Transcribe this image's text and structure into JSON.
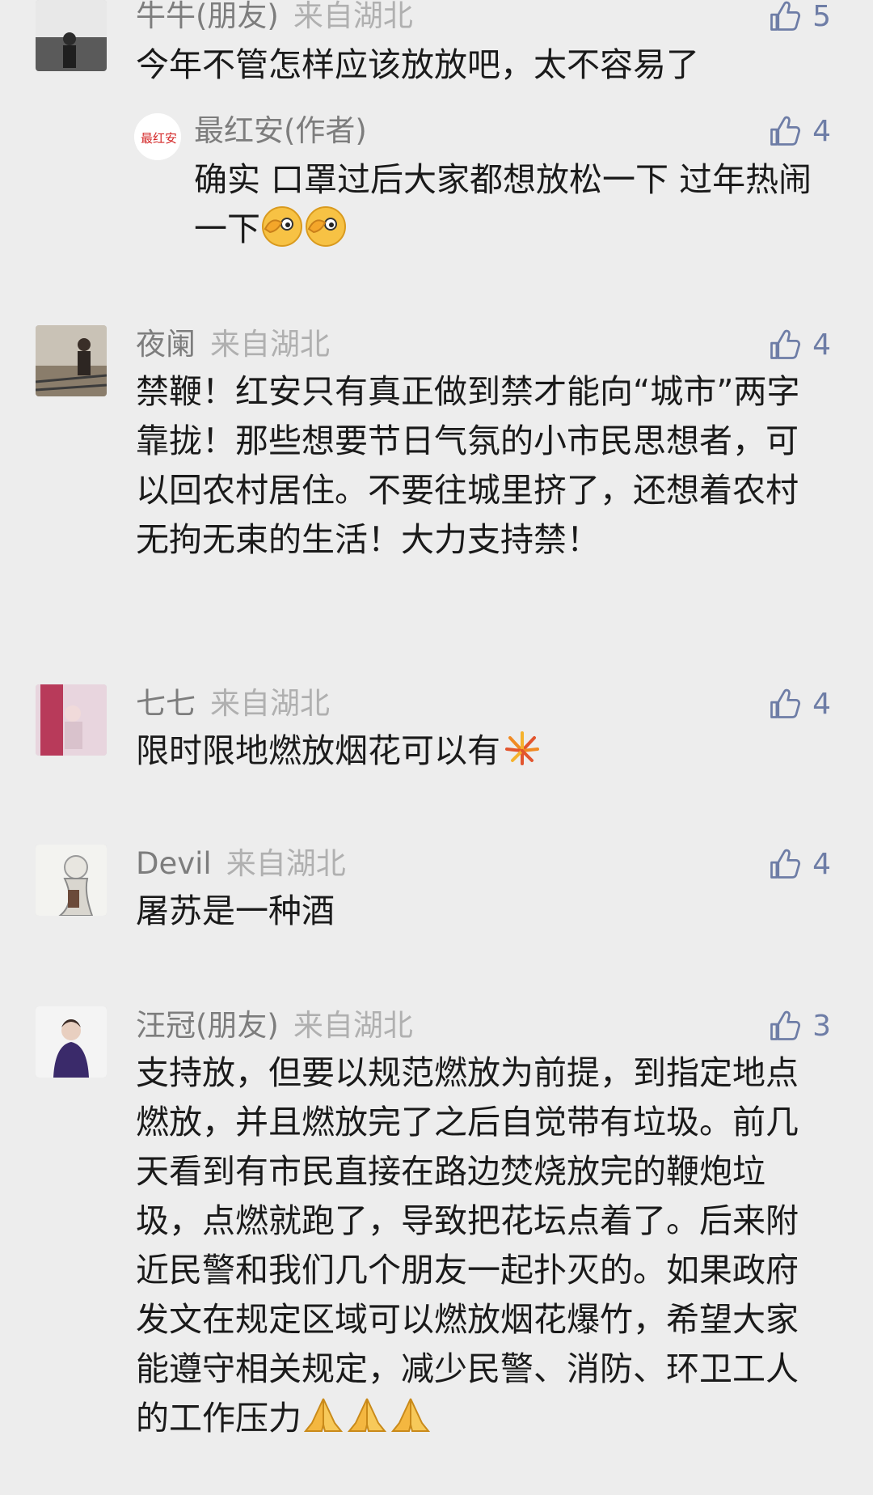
{
  "comments": [
    {
      "name": "牛牛(朋友)",
      "location": "来自湖北",
      "text": "今年不管怎样应该放放吧，太不容易了",
      "likes": "5",
      "reply": {
        "name": "最红安(作者)",
        "text": "确实 口罩过后大家都想放松一下  过年热闹一下",
        "likes": "4",
        "avatar_text": "最红安"
      }
    },
    {
      "name": "夜阑",
      "location": "来自湖北",
      "text": "禁鞭！红安只有真正做到禁才能向“城市”两字靠拢！那些想要节日气氛的小市民思想者，可以回农村居住。不要往城里挤了，还想着农村无拘无束的生活！大力支持禁！",
      "likes": "4"
    },
    {
      "name": "七七",
      "location": "来自湖北",
      "text": "限时限地燃放烟花可以有",
      "likes": "4"
    },
    {
      "name": "Devil",
      "location": "来自湖北",
      "text": "屠苏是一种酒",
      "likes": "4"
    },
    {
      "name": "汪冠(朋友)",
      "location": "来自湖北",
      "text": "支持放，但要以规范燃放为前提，到指定地点燃放，并且燃放完了之后自觉带有垃圾。前几天看到有市民直接在路边焚烧放完的鞭炮垃圾，点燃就跑了，导致把花坛点着了。后来附近民警和我们几个朋友一起扑灭的。如果政府发文在规定区域可以燃放烟花爆竹，希望大家能遵守相关规定，减少民警、消防、环卫工人的工作压力",
      "likes": "3"
    }
  ],
  "icons": {
    "like": "thumbs-up-icon",
    "reply_emoji": "facepalm-emoji",
    "fireworks_emoji": "fireworks-emoji",
    "pray_emoji": "praying-hands-emoji"
  },
  "colors": {
    "background": "#ededed",
    "name": "#7d7d7d",
    "location": "#b0b0b0",
    "like": "#6e7da6",
    "text": "#1a1a1a"
  }
}
